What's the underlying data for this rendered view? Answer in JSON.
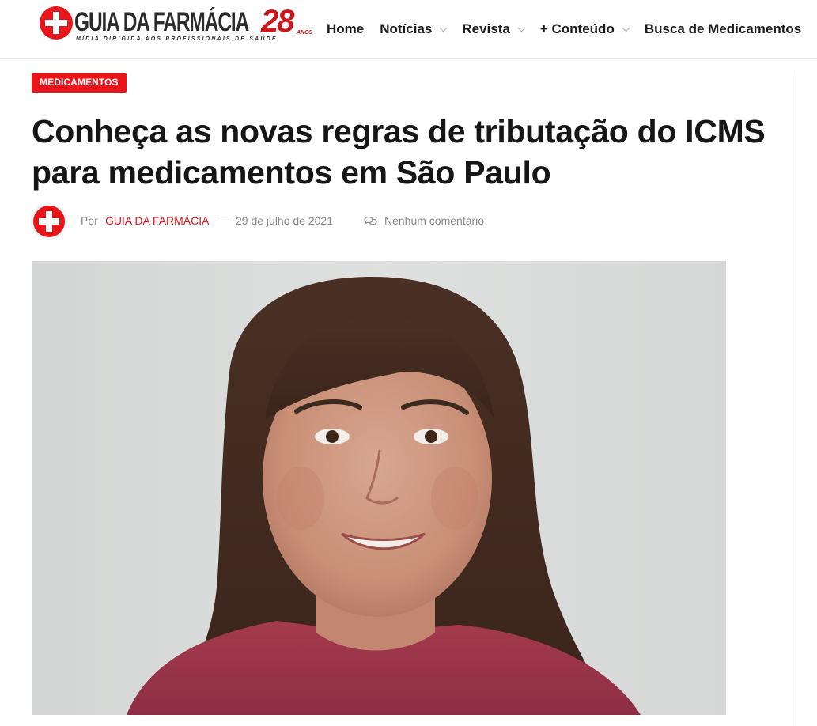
{
  "header": {
    "logo": {
      "text": "GUIA DA FARMÁCIA",
      "years": "28",
      "years_suffix": "ANOS",
      "tagline": "MÍDIA DIRIGIDA AOS PROFISSIONAIS DE SAÚDE"
    },
    "nav": [
      {
        "label": "Home",
        "has_dropdown": false
      },
      {
        "label": "Notícias",
        "has_dropdown": true
      },
      {
        "label": "Revista",
        "has_dropdown": true
      },
      {
        "label": "+ Conteúdo",
        "has_dropdown": true
      },
      {
        "label": "Busca de Medicamentos",
        "has_dropdown": false
      }
    ]
  },
  "article": {
    "category": "MEDICAMENTOS",
    "title": "Conheça as novas regras de tributação do ICMS para medicamentos em São Paulo",
    "meta": {
      "by_label": "Por",
      "author": "GUIA DA FARMÁCIA",
      "separator": "—",
      "date": "29 de julho de 2021",
      "comments": "Nenhum comentário"
    }
  },
  "colors": {
    "brand_red": "#e8161a",
    "text_dark": "#161616",
    "meta_gray": "#8a8a8a"
  }
}
